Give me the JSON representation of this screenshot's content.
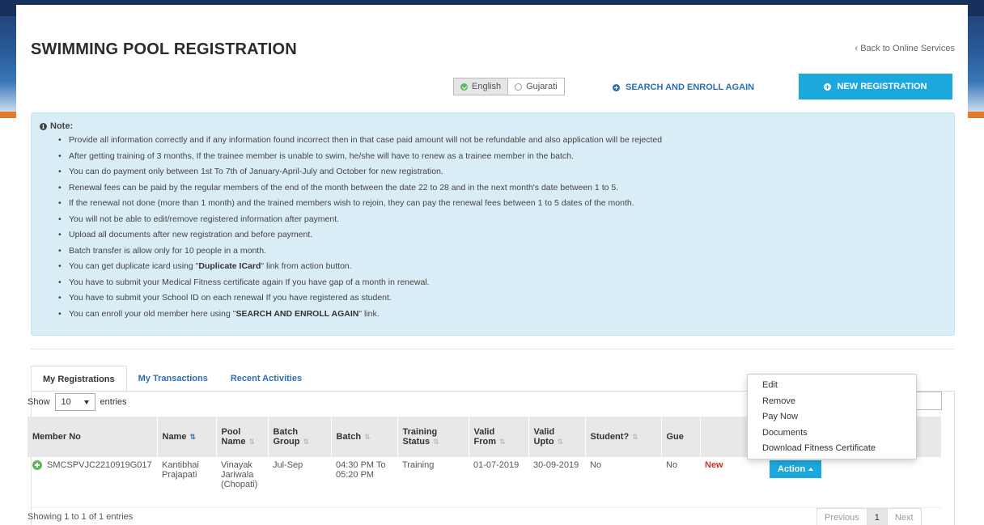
{
  "header": {
    "title": "SWIMMING POOL REGISTRATION",
    "back_link": "‹ Back to Online Services"
  },
  "language": {
    "options": [
      "English",
      "Gujarati"
    ],
    "selected": "English"
  },
  "actions": {
    "search_enroll": "SEARCH AND ENROLL AGAIN",
    "new_registration": "NEW REGISTRATION"
  },
  "note": {
    "title": "Note:",
    "items": [
      "Provide all information correctly and if any information found incorrect then in that case paid amount will not be refundable and also application will be rejected",
      "After getting training of 3 months, If the trainee member is unable to swim, he/she will have to renew as a trainee member in the batch.",
      "You can do payment only between 1st To 7th of January-April-July and October for new registration.",
      "Renewal fees can be paid by the regular members of the end of the month between the date 22 to 28 and in the next month's date between 1 to 5.",
      "If the renewal not done (more than 1 month) and the trained members wish to rejoin, they can pay the renewal fees between 1 to 5 dates of the month.",
      "You will not be able to edit/remove registered information after payment.",
      "Upload all documents after new registration and before payment.",
      "Batch transfer is allow only for 10 people in a month.",
      "You can get duplicate icard using \"Duplicate ICard\" link from action button.",
      "You have to submit your Medical Fitness certificate again If you have gap of a month in renewal.",
      "You have to submit your School ID on each renewal If you have registered as student.",
      "You can enroll your old member here using \"SEARCH AND ENROLL AGAIN\" link."
    ]
  },
  "tabs": [
    {
      "label": "My Registrations",
      "active": true
    },
    {
      "label": "My Transactions",
      "active": false
    },
    {
      "label": "Recent Activities",
      "active": false
    }
  ],
  "table_controls": {
    "show_label": "Show",
    "page_size": "10",
    "entries_label": "entries"
  },
  "table": {
    "headers": [
      "Member No",
      "Name",
      "Pool Name",
      "Batch Group",
      "Batch",
      "Training Status",
      "Valid From",
      "Valid Upto",
      "Student?",
      "Gue",
      "",
      ""
    ],
    "rows": [
      {
        "member_no": "SMCSPVJC2210919G017",
        "name": "Kantibhai Prajapati",
        "pool_name": "Vinayak Jariwala (Chopati)",
        "batch_group": "Jul-Sep",
        "batch": "04:30 PM To 05:20 PM",
        "training_status": "Training",
        "valid_from": "01-07-2019",
        "valid_upto": "30-09-2019",
        "student": "No",
        "guest": "No",
        "status": "New",
        "action_label": "Action"
      }
    ]
  },
  "action_menu": [
    "Edit",
    "Remove",
    "Pay Now",
    "Documents",
    "Download Fitness Certificate"
  ],
  "footer": {
    "showing": "Showing 1 to 1 of 1 entries",
    "prev": "Previous",
    "page": "1",
    "next": "Next"
  },
  "colors": {
    "primary": "#1ca8dd",
    "link": "#2b6fb0",
    "note_bg": "#d9edf7",
    "status_new": "#c0392b",
    "success": "#5cb85c"
  }
}
